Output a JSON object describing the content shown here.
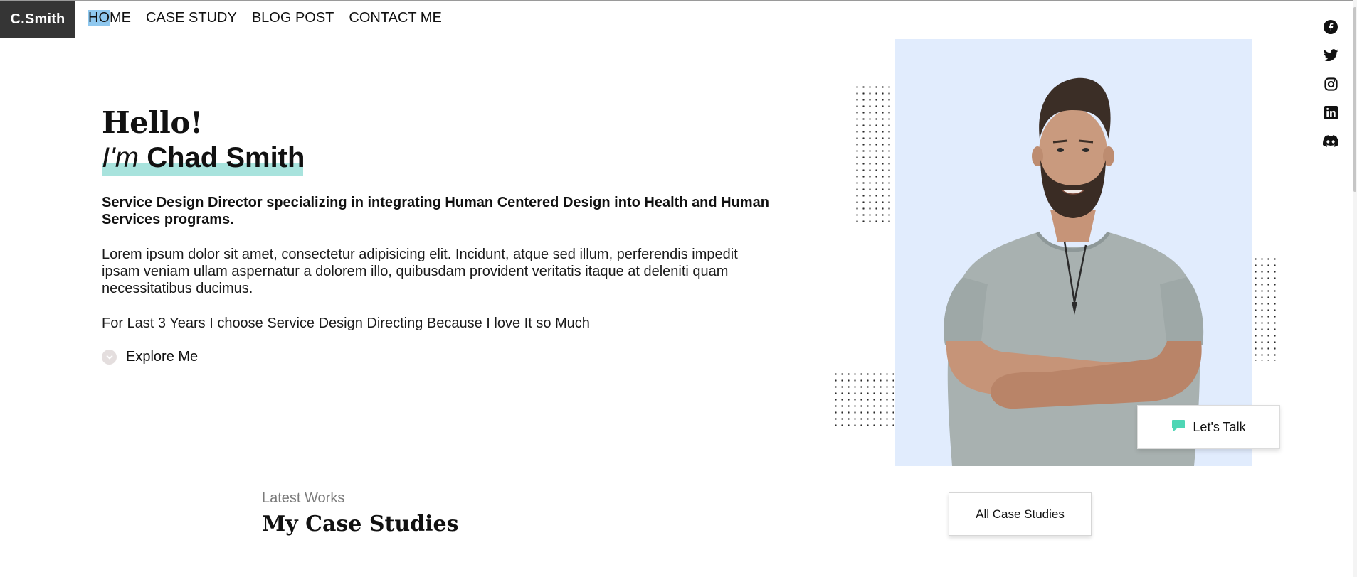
{
  "brand": {
    "logo": "C.Smith"
  },
  "nav": {
    "items": [
      {
        "label_hl": "HO",
        "label_rest": "ME"
      },
      {
        "label": "CASE STUDY"
      },
      {
        "label": "BLOG POST"
      },
      {
        "label": "CONTACT ME"
      }
    ]
  },
  "social": [
    "facebook-icon",
    "twitter-icon",
    "instagram-icon",
    "linkedin-icon",
    "discord-icon"
  ],
  "hero": {
    "greeting": "Hello!",
    "im": "I'm",
    "name": "Chad Smith",
    "subtitle": "Service Design Director specializing in integrating Human Centered Design into Health and Human Services programs.",
    "description": "Lorem ipsum dolor sit amet, consectetur adipisicing elit. Incidunt, atque sed illum, perferendis impedit ipsam veniam ullam aspernatur a dolorem illo, quibusdam provident veritatis itaque at deleniti quam necessitatibus ducimus.",
    "tagline": "For Last 3 Years I choose Service Design Directing Because I love It so Much",
    "explore": "Explore Me"
  },
  "talk": {
    "label": "Let's Talk"
  },
  "works": {
    "kicker": "Latest Works",
    "title": "My Case Studies",
    "button": "All Case Studies"
  },
  "colors": {
    "logo_bg": "#353535",
    "name_highlight": "#a8e3dd",
    "nav_highlight": "#8fc8ef",
    "photo_bg": "#e1ecfd",
    "talk_icon": "#4fd6b5"
  }
}
